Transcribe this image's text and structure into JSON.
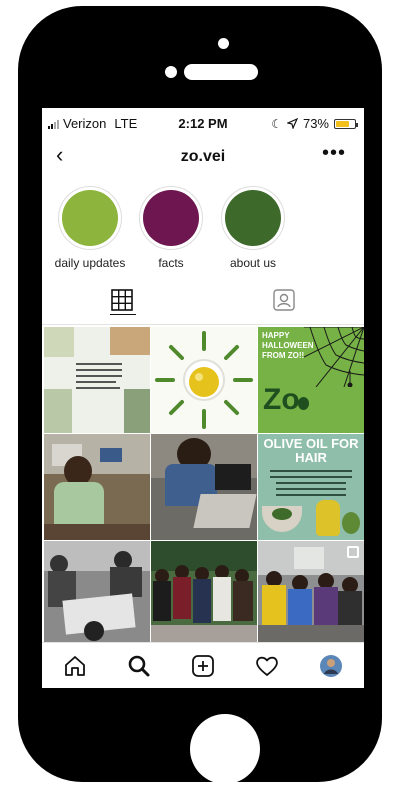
{
  "status_bar": {
    "carrier": "Verizon",
    "network": "LTE",
    "time": "2:12 PM",
    "battery_percent": "73%",
    "battery_level": 0.73,
    "icons": [
      "signal-icon",
      "moon-icon",
      "location-arrow-icon",
      "battery-icon"
    ]
  },
  "profile": {
    "handle": "zo.vei",
    "back_icon": "chevron-left-icon",
    "more_icon": "more-dots-icon"
  },
  "highlights": [
    {
      "label": "daily updates",
      "color": "#8db43c"
    },
    {
      "label": "facts",
      "color": "#6e1650"
    },
    {
      "label": "about us",
      "color": "#3d6a2a"
    }
  ],
  "tabs": [
    {
      "name": "grid",
      "icon": "grid-icon",
      "active": true
    },
    {
      "name": "tagged",
      "icon": "tagged-icon",
      "active": false
    }
  ],
  "posts": {
    "tile3_title": "HAPPY HALLOWEEN FROM ZO!!",
    "tile3_logo": "Zo",
    "tile6_title": "OLIVE OIL FOR HAIR",
    "colors": {
      "halloween_green": "#76b245",
      "olive_teal": "#8fbfaa",
      "olive_oil": "#e6c21c"
    }
  },
  "bottom_nav": [
    {
      "name": "home",
      "icon": "home-icon"
    },
    {
      "name": "search",
      "icon": "search-icon"
    },
    {
      "name": "new-post",
      "icon": "plus-square-icon"
    },
    {
      "name": "activity",
      "icon": "heart-icon"
    },
    {
      "name": "profile",
      "icon": "avatar-icon"
    }
  ]
}
